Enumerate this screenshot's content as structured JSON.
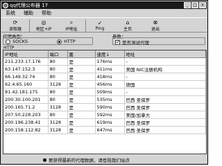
{
  "window": {
    "title": "qq代理公布器 17"
  },
  "menus": [
    "系统",
    "辅助",
    "帮助"
  ],
  "toolbar": [
    {
      "icon": "refresh-icon",
      "glyph": "⟳",
      "label": "读取器"
    },
    {
      "icon": "location-icon",
      "glyph": "◎",
      "label": "地区+IP"
    },
    {
      "icon": "binoculars-icon",
      "glyph": "⌕",
      "label": "IP地址"
    },
    {
      "icon": "ping-icon",
      "glyph": "✓",
      "label": "Ping"
    },
    {
      "icon": "home-icon",
      "glyph": "⌂",
      "label": "主页"
    },
    {
      "icon": "exit-icon",
      "glyph": "⊗",
      "label": "退出"
    }
  ],
  "options": {
    "proxy_type_label": "代理类型：",
    "socks_label": "SOCKS",
    "http_label": "HTTP",
    "params_label": "参数：",
    "test_label": "是否测试代理"
  },
  "http_section": "HTTP",
  "table": {
    "columns": [
      "IP地址",
      "端口",
      "匿",
      "速度↓",
      "地址"
    ],
    "rows": [
      [
        "211.233.17.176",
        "80",
        "是",
        "176ms",
        "-"
      ],
      [
        "63.147.152.3",
        "80",
        "是",
        "411ms",
        "美国 NIC注册机构"
      ],
      [
        "66.149.32.74",
        "80",
        "是",
        "418ms",
        "-"
      ],
      [
        "62.4.65.160",
        "3128",
        "是",
        "456ms",
        "德国"
      ],
      [
        "81.42.181.175",
        "80",
        "是",
        "509ms",
        "-"
      ],
      [
        "200.30.100.201",
        "80",
        "是",
        "535ms",
        "巴西 圣保罗"
      ],
      [
        "200.165.71.2",
        "3128",
        "是",
        "590ms",
        "巴西 圣保罗"
      ],
      [
        "207.50.228.203",
        "80",
        "是",
        "592ms",
        "美国/加拿大"
      ],
      [
        "200.196.238.41",
        "3128",
        "是",
        "619ms",
        "巴西 圣保罗"
      ],
      [
        "200.158.112.82",
        "3128",
        "是",
        "647ms",
        "巴西 圣保罗"
      ]
    ]
  },
  "status": "要获得最新的代理数据，请登陆我们站点"
}
